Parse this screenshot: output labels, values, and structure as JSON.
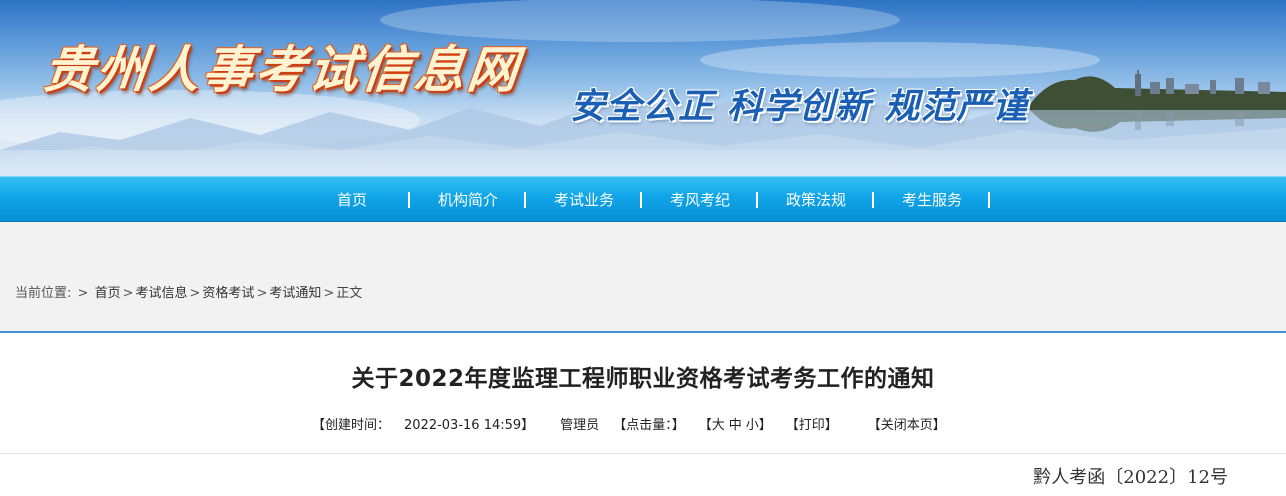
{
  "banner": {
    "site_title": "贵州人事考试信息网",
    "slogan": "安全公正  科学创新  规范严谨"
  },
  "nav": {
    "items": [
      {
        "label": "首页"
      },
      {
        "label": "机构简介"
      },
      {
        "label": "考试业务"
      },
      {
        "label": "考风考纪"
      },
      {
        "label": "政策法规"
      },
      {
        "label": "考生服务"
      }
    ]
  },
  "breadcrumb": {
    "label": "当前位置:",
    "items": [
      "首页",
      "考试信息",
      "资格考试",
      "考试通知",
      "正文"
    ]
  },
  "article": {
    "title": "关于2022年度监理工程师职业资格考试考务工作的通知",
    "created_label": "【创建时间：",
    "created_value": "2022-03-16 14:59】",
    "author": "管理员",
    "clicks": "【点击量：】",
    "size_open": "【",
    "size_large": "大",
    "size_medium": "中",
    "size_small": "小",
    "size_close": "】",
    "print": "【打印】",
    "close": "【关闭本页】",
    "doc_number": "黔人考函〔2022〕12号"
  },
  "colors": {
    "nav_blue": "#10a5e8",
    "accent_line": "#3d8ed6",
    "title_orange": "#e46420",
    "slogan_blue": "#1b5fb5"
  }
}
